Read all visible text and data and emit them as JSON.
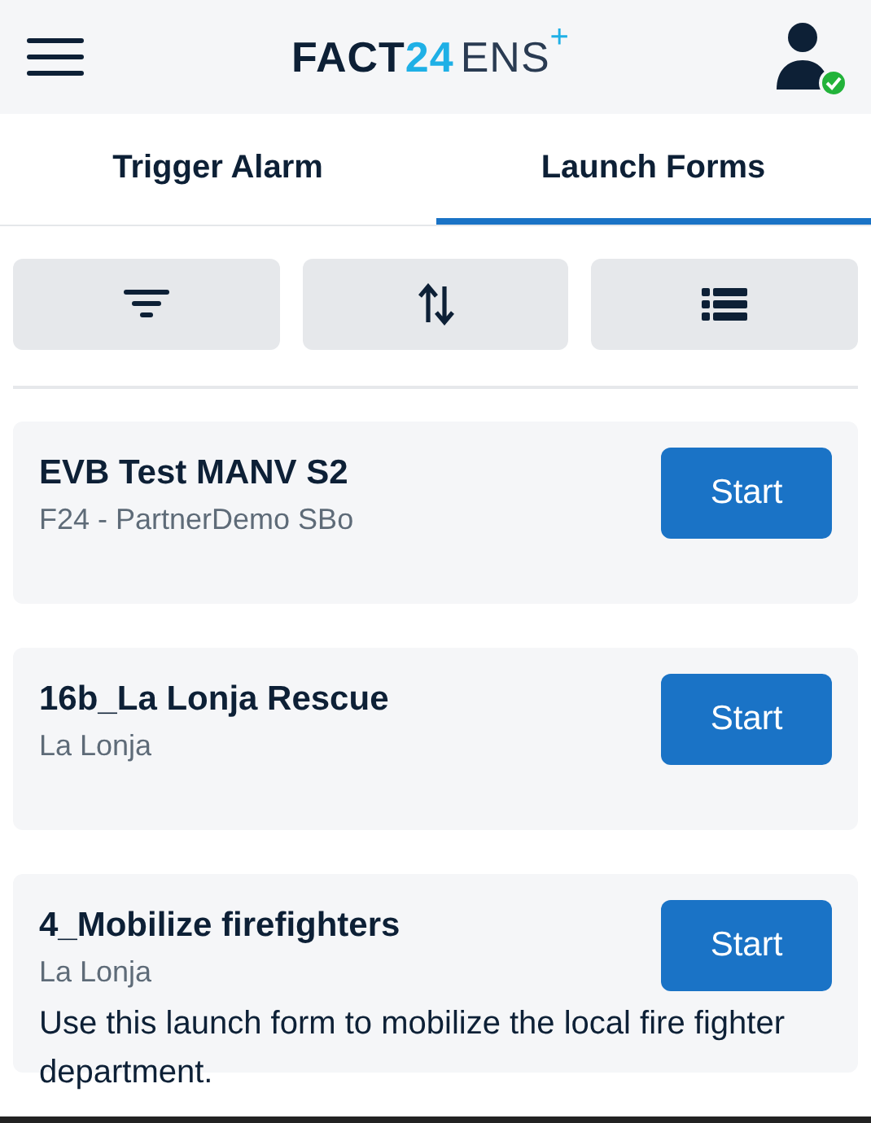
{
  "header": {
    "logo": {
      "brand": "FACT",
      "number": "24",
      "product": "ENS",
      "plus": "+"
    },
    "user": {
      "online": true
    }
  },
  "tabs": [
    {
      "label": "Trigger Alarm",
      "selected": false
    },
    {
      "label": "Launch Forms",
      "selected": true
    }
  ],
  "toolbar": [
    {
      "kind": "filter"
    },
    {
      "kind": "sort"
    },
    {
      "kind": "list"
    }
  ],
  "forms": [
    {
      "title": "EVB Test MANV S2",
      "subtitle": "F24 - PartnerDemo SBo",
      "button": "Start"
    },
    {
      "title": "16b_La Lonja Rescue",
      "subtitle": "La Lonja",
      "button": "Start"
    },
    {
      "title": "4_Mobilize firefighters",
      "subtitle": "La Lonja",
      "description": "Use this launch form to mobilize the local fire fighter department.",
      "button": "Start"
    }
  ]
}
